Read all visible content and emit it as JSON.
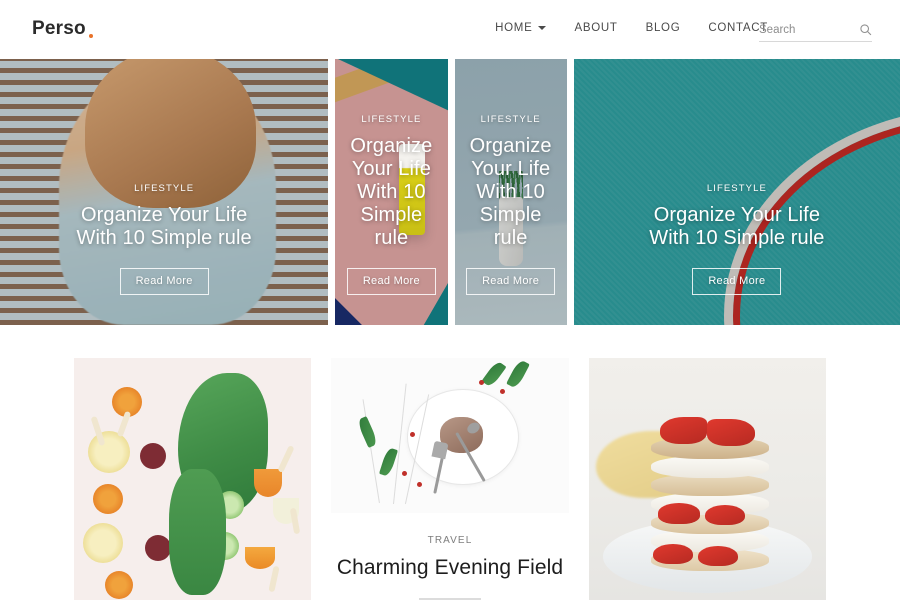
{
  "header": {
    "brand": "Perso",
    "brand_accent_color": "#e8732a",
    "nav": [
      {
        "label": "HOME",
        "has_dropdown": true,
        "icon": "chevron-down-icon"
      },
      {
        "label": "ABOUT",
        "has_dropdown": false
      },
      {
        "label": "BLOG",
        "has_dropdown": false
      },
      {
        "label": "CONTACT",
        "has_dropdown": false
      }
    ],
    "search": {
      "placeholder": "Search",
      "value": "",
      "icon": "search-icon"
    }
  },
  "hero": {
    "cards": [
      {
        "category": "LIFESTYLE",
        "title_line1": "Organize Your Life",
        "title_line2": "With 10 Simple rule",
        "button": "Read More",
        "image_alt": "woman-in-blue-knit-sweater-against-wooden-blinds"
      },
      {
        "category": "LIFESTYLE",
        "title_line1": "Organize Your Life",
        "title_line2": "With 10 Simple rule",
        "button": "Read More",
        "image_alt": "hand-holding-yellow-coffee-cup-against-pink-mural-wall"
      },
      {
        "category": "LIFESTYLE",
        "title_line1": "Organize Your Life",
        "title_line2": "With 10 Simple rule",
        "button": "Read More",
        "image_alt": "potted-succulent-plant-on-blue-grey-background"
      },
      {
        "category": "LIFESTYLE",
        "title_line1": "Organize Your Life",
        "title_line2": "With 10 Simple rule",
        "button": "Read More",
        "image_alt": "red-and-white-bicycle-wheel-against-teal-wall"
      }
    ]
  },
  "posts": [
    {
      "image_alt": "kale-carrots-citrus-and-cucumber-flatlay-on-pink-background",
      "category": "",
      "title": ""
    },
    {
      "image_alt": "white-plate-with-pinecone-fork-spoon-and-berries-on-white-table",
      "category": "TRAVEL",
      "title": "Charming Evening Field"
    },
    {
      "image_alt": "pancake-stack-with-strawberries-cream-and-banana",
      "category": "",
      "title": ""
    }
  ]
}
